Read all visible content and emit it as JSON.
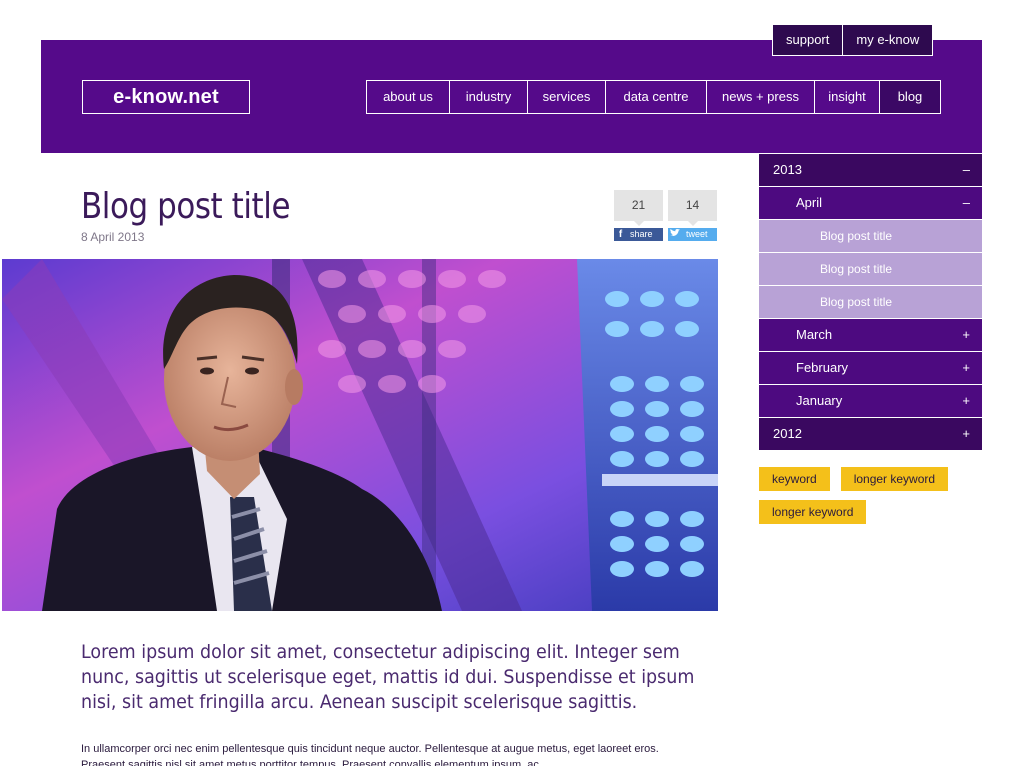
{
  "utility_nav": [
    "support",
    "my e-know"
  ],
  "brand": {
    "logo_text": "e-know.net"
  },
  "main_nav": [
    "about us",
    "industry",
    "services",
    "data centre",
    "news + press",
    "insight",
    "blog"
  ],
  "post": {
    "title": "Blog post title",
    "date": "8 April 2013",
    "share": {
      "facebook_count": "21",
      "facebook_label": "share",
      "twitter_count": "14",
      "twitter_label": "tweet"
    },
    "lead": "Lorem ipsum dolor sit amet, consectetur adipiscing elit. Integer sem nunc, sagittis ut scelerisque eget, mattis id dui. Suspendisse et ipsum nisi, sit amet fringilla arcu. Aenean suscipit scelerisque sagittis.",
    "body": "In ullamcorper orci nec enim pellentesque quis tincidunt neque auctor. Pellentesque at augue metus, eget laoreet eros. Praesent sagittis nisl sit amet metus porttitor tempus. Praesent convallis elementum ipsum, ac"
  },
  "archive": [
    {
      "label": "2013",
      "toggle": "–"
    },
    {
      "label": "April",
      "toggle": "–"
    },
    {
      "label": "Blog post title"
    },
    {
      "label": "Blog post title"
    },
    {
      "label": "Blog post title"
    },
    {
      "label": "March",
      "toggle": "+"
    },
    {
      "label": "February",
      "toggle": "+"
    },
    {
      "label": "January",
      "toggle": "+"
    },
    {
      "label": "2012",
      "toggle": "+"
    }
  ],
  "tags": [
    "keyword",
    "longer keyword",
    "longer keyword"
  ],
  "colors": {
    "brand_purple": "#550a8a",
    "dark_purple": "#3a0860",
    "month_purple": "#4d0a80",
    "post_lilac": "#b8a2d6",
    "tag_yellow": "#f4c01a"
  }
}
